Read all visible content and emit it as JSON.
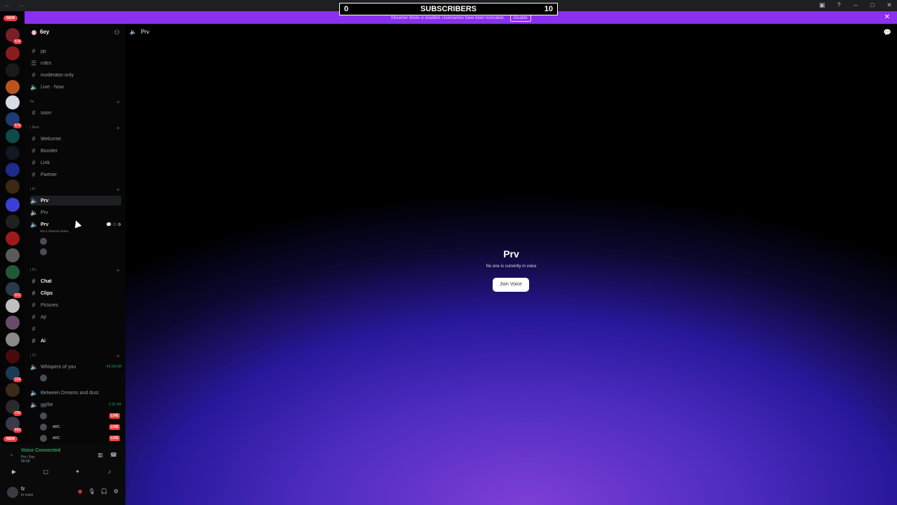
{
  "titlebar": {
    "nav": "← →"
  },
  "subscribers": {
    "label": "SUBSCRIBERS",
    "current": "0",
    "goal": "10"
  },
  "banner": {
    "text": "Streamer Mode is enabled. Usernames have been truncated.",
    "disable": "Disable"
  },
  "rail": {
    "new_top": "NEW",
    "new_bottom": "NEW",
    "badges": [
      "418",
      "670",
      "479",
      "372",
      "103",
      "790",
      "463"
    ]
  },
  "server": {
    "name": "6ey"
  },
  "channels": {
    "pp": "pp",
    "rules": "rules",
    "moderator_only": "moderator-only",
    "live_now": "Live · Now",
    "cat_6e": "6e",
    "soon": "soon",
    "cat_new": "| New",
    "welcome": "Welcome",
    "booster": "Booster",
    "link": "Link",
    "partner": "Partner",
    "cat_pr": "| Pr",
    "prv1": "Prv",
    "prv2": "Prv",
    "prv3": "Prv",
    "set_status": "Set a channel status",
    "cat_pu": "| Pu",
    "chat": "Chat",
    "clips": "Clips",
    "pictures": "Pictures",
    "ajr": "Ajr",
    "ai": "Ai",
    "cat_cc": "| Cc",
    "whispers": "Whispers of you",
    "whispers_time": "41:54:18",
    "between": "Between Dreams and dust",
    "gg6e": "gg/6e",
    "gg6e_time": "1:21:43",
    "live_label": "LIVE",
    "arc": "ARC"
  },
  "voice": {
    "status": "Voice Connected",
    "location": "Prv / 6ey",
    "timer": "00:18"
  },
  "user": {
    "name": "fz",
    "status": "In voice"
  },
  "main": {
    "channel": "Prv",
    "title": "Prv",
    "empty": "No one is currently in voice",
    "join": "Join Voice"
  },
  "colors": {
    "accent": "#8b2ff0",
    "online": "#23a55a",
    "live": "#f23f43"
  }
}
